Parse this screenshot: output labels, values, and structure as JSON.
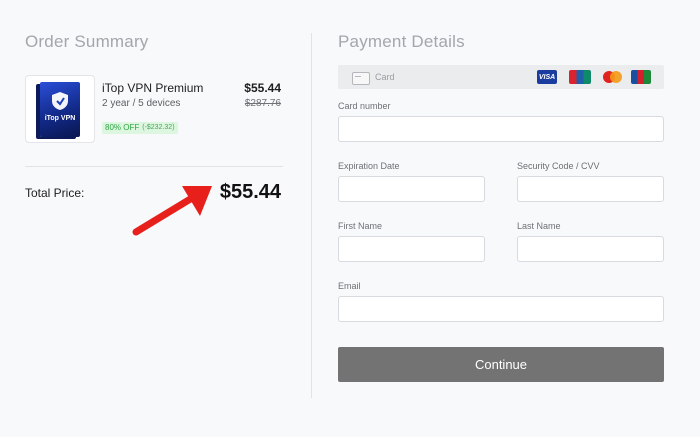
{
  "order_summary": {
    "title": "Order Summary",
    "product": {
      "image_text": "iTop VPN",
      "name": "iTop VPN Premium",
      "plan": "2 year / 5 devices",
      "price": "$55.44",
      "old_price": "$287.76",
      "discount": "80% OFF",
      "savings": "(-$232.32)"
    },
    "total_label": "Total Price:",
    "total_value": "$55.44"
  },
  "payment": {
    "title": "Payment Details",
    "method_label": "Card",
    "brands": [
      "visa",
      "unionpay",
      "mastercard",
      "jcb"
    ],
    "brand_visa_text": "VISA",
    "fields": {
      "card_number": "Card number",
      "expiration": "Expiration Date",
      "cvv": "Security Code / CVV",
      "first_name": "First Name",
      "last_name": "Last Name",
      "email": "Email"
    },
    "continue_label": "Continue"
  },
  "colors": {
    "arrow": "#e8201b",
    "button": "#737373",
    "badge_bg": "#dcf6df",
    "badge_text": "#2fa743"
  },
  "icons": [
    "card-icon",
    "shield-icon",
    "arrow-annotation"
  ]
}
